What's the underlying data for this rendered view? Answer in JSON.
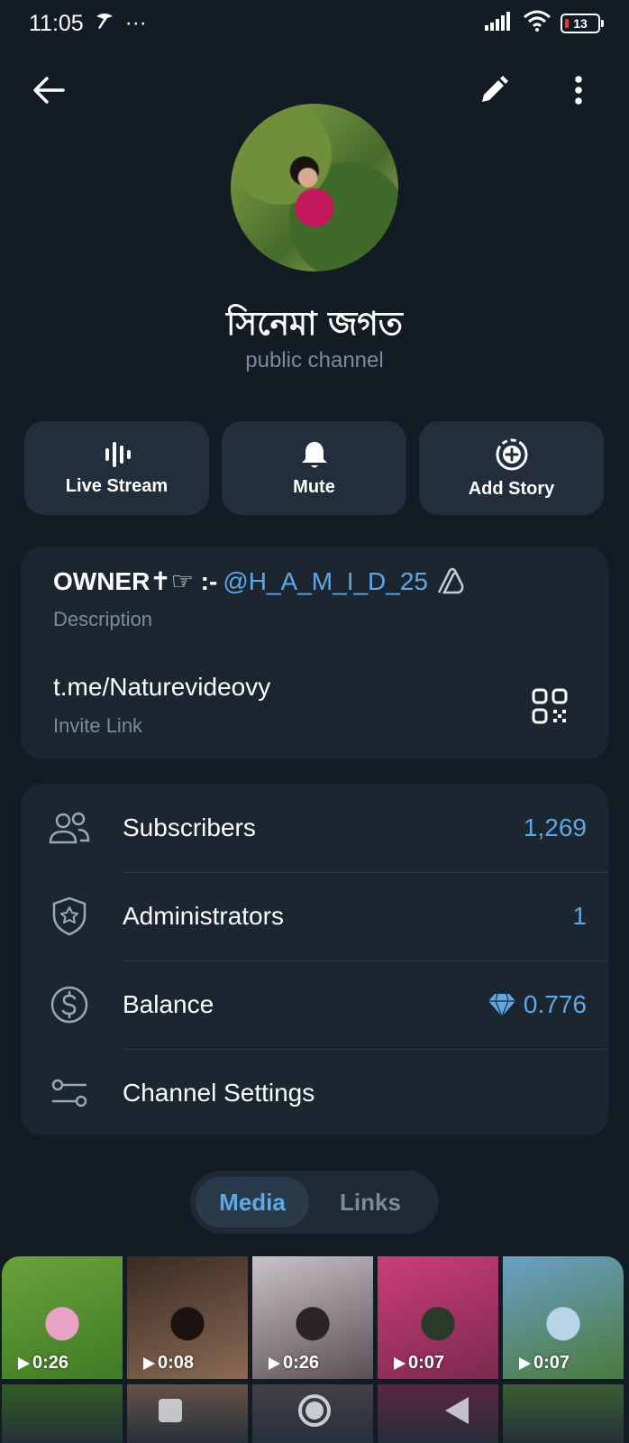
{
  "status_bar": {
    "time": "11:05",
    "extra": "···",
    "battery": "13"
  },
  "profile": {
    "name": "সিনেমা জগত",
    "type": "public channel"
  },
  "actions": [
    {
      "label": "Live Stream",
      "icon": "live-stream-icon"
    },
    {
      "label": "Mute",
      "icon": "bell-icon"
    },
    {
      "label": "Add Story",
      "icon": "add-story-icon"
    }
  ],
  "info": {
    "owner_prefix": "OWNER✝☞ :-",
    "owner_mention": "@H_A_M_I_D_25",
    "description_label": "Description",
    "invite_link": "t.me/Naturevideovy",
    "invite_label": "Invite Link"
  },
  "stats": {
    "subscribers": {
      "label": "Subscribers",
      "value": "1,269"
    },
    "administrators": {
      "label": "Administrators",
      "value": "1"
    },
    "balance": {
      "label": "Balance",
      "value": "0.776"
    },
    "settings": {
      "label": "Channel Settings"
    }
  },
  "tabs": {
    "media": "Media",
    "links": "Links"
  },
  "media": [
    {
      "duration": "0:26",
      "colors": [
        "#6aa33a",
        "#3f7a26",
        "#e8a3c4"
      ]
    },
    {
      "duration": "0:08",
      "colors": [
        "#3a2a22",
        "#8a6a55",
        "#1c1412"
      ]
    },
    {
      "duration": "0:26",
      "colors": [
        "#c9c2c6",
        "#5a4f55",
        "#2a2428"
      ]
    },
    {
      "duration": "0:07",
      "colors": [
        "#cc3d7a",
        "#7a2a4c",
        "#2a3a2a"
      ]
    },
    {
      "duration": "0:07",
      "colors": [
        "#6aa0c8",
        "#4a7a3a",
        "#b8d5e8"
      ]
    }
  ],
  "colors": {
    "accent": "#5ea8e6",
    "background": "#131b24",
    "card": "#1c2631"
  }
}
